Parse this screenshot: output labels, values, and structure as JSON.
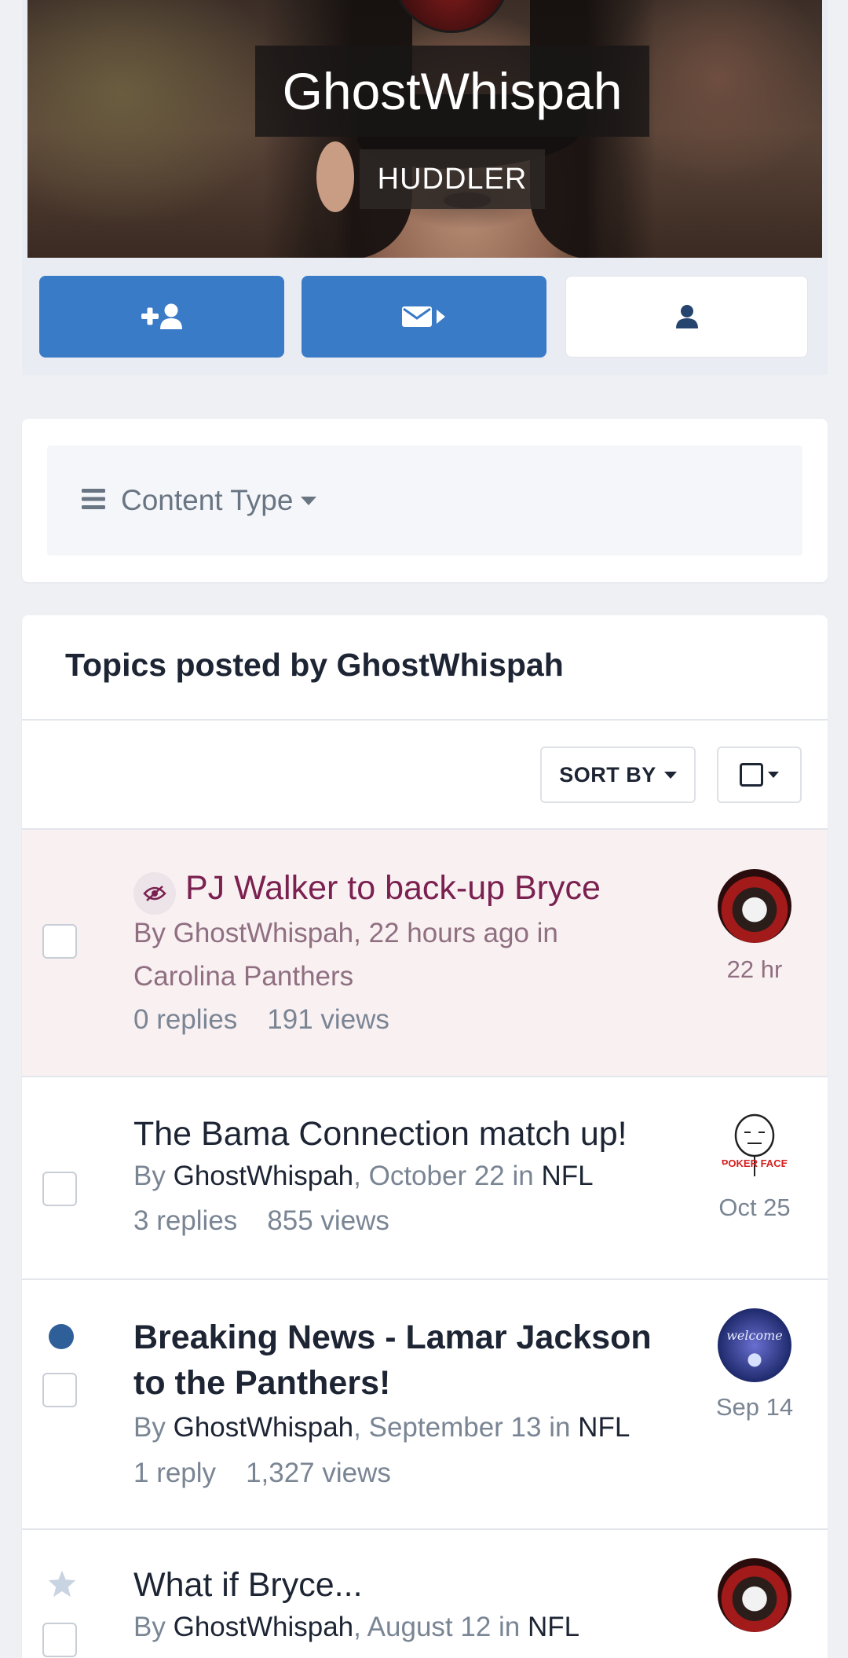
{
  "profile": {
    "name": "GhostWhispah",
    "title": "HUDDLER"
  },
  "actions": [
    {
      "icon": "user-plus-icon"
    },
    {
      "icon": "envelope-arrow-icon"
    },
    {
      "icon": "user-icon"
    }
  ],
  "filter": {
    "label": "Content Type",
    "icon": "menu-icon"
  },
  "topics": {
    "heading": "Topics posted by GhostWhispah",
    "sort_label": "SORT BY",
    "rows": [
      {
        "title": "PJ Walker to back-up Bryce",
        "by": "By",
        "author": "GhostWhispah",
        "when": ", 22 hours ago in",
        "forum": "Carolina Panthers",
        "replies": "0 replies",
        "views": "191 views",
        "last_time": "22 hr",
        "hidden": true
      },
      {
        "title": "The Bama Connection match up!",
        "by": "By",
        "author": "GhostWhispah",
        "when": ", October 22 in",
        "forum": "NFL",
        "replies": "3 replies",
        "views": "855 views",
        "last_time": "Oct 25"
      },
      {
        "title": "Breaking News - Lamar Jackson to the Panthers!",
        "by": "By",
        "author": "GhostWhispah",
        "when": ", September 13 in",
        "forum": "NFL",
        "replies": "1 reply",
        "views": "1,327 views",
        "last_time": "Sep 14",
        "unread": true
      },
      {
        "title": "What if Bryce...",
        "by": "By",
        "author": "GhostWhispah",
        "when": ", August 12 in",
        "forum": "NFL"
      }
    ]
  },
  "avatar_texts": {
    "poker": "POKER FACE",
    "welcome": "welcome"
  },
  "colors": {
    "primary_button": "#3a7bc8",
    "hidden_topic_title": "#7a2150",
    "unread_dot": "#2f5f98"
  }
}
